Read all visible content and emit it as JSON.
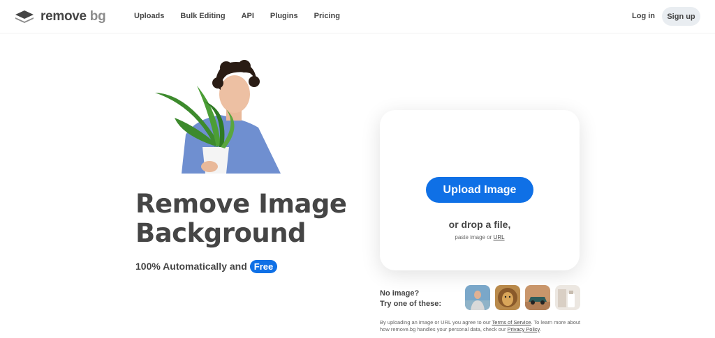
{
  "brand": {
    "name_main": "remove",
    "name_suffix": "bg",
    "logo_icon": "layers-logo-icon"
  },
  "nav": {
    "links": [
      "Uploads",
      "Bulk Editing",
      "API",
      "Plugins",
      "Pricing"
    ],
    "login": "Log in",
    "signup": "Sign up"
  },
  "hero": {
    "title_line1": "Remove Image",
    "title_line2": "Background",
    "subtitle": "100% Automatically and",
    "badge": "Free"
  },
  "upload": {
    "button": "Upload Image",
    "drop": "or drop a file,",
    "paste_prefix": "paste image or",
    "paste_link": "URL"
  },
  "samples": {
    "line1": "No image?",
    "line2": "Try one of these:",
    "items": [
      "sample-person",
      "sample-animal",
      "sample-car",
      "sample-product"
    ]
  },
  "terms": {
    "part1": "By uploading an image or URL you agree to our",
    "tos": "Terms of Service",
    "part2": ". To learn more about how remove.bg handles your personal data, check our",
    "privacy": "Privacy Policy",
    "part3": "."
  },
  "colors": {
    "accent": "#0f70e6",
    "text": "#454545",
    "signup_bg": "#e9edf1"
  }
}
